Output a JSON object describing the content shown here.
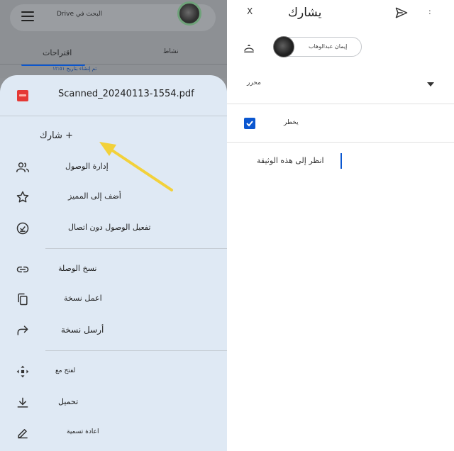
{
  "drive": {
    "search_placeholder": "البحث في Drive",
    "tabs": [
      "اقتراحات",
      "نشاط"
    ],
    "faint_row": "تم إنشاء بتاريخ ١٢:٥١"
  },
  "sheet": {
    "file_name": "Scanned_20240113-1554.pdf",
    "share_label": "+ شارك",
    "menu": [
      {
        "label": "إدارة الوصول",
        "icon": "people-icon"
      },
      {
        "label": "أضف إلى المميز",
        "icon": "star-icon"
      },
      {
        "label": "تفعيل الوصول دون اتصال",
        "icon": "offline-check-icon"
      },
      {
        "label": "نسخ الوصلة",
        "icon": "link-icon"
      },
      {
        "label": "اعمل نسخة",
        "icon": "copy-icon"
      },
      {
        "label": "أرسل نسخة",
        "icon": "forward-icon"
      },
      {
        "label": "لفتح مع",
        "icon": "open-with-icon"
      },
      {
        "label": "تحميل",
        "icon": "download-icon"
      },
      {
        "label": "اعادة تسمية",
        "icon": "rename-icon"
      }
    ]
  },
  "share_dialog": {
    "close": "X",
    "title": "يشارك",
    "more": ":",
    "chip_name": "إيمان عبدالوهاب",
    "role": "محرر",
    "notify_label": "يخطر",
    "message": "انظر إلى هذه الوثيقة"
  },
  "colors": {
    "accent": "#0b57d0",
    "pdf_red": "#e53935",
    "sheet_bg": "#dfe9f4",
    "arrow": "#f2d13a"
  }
}
